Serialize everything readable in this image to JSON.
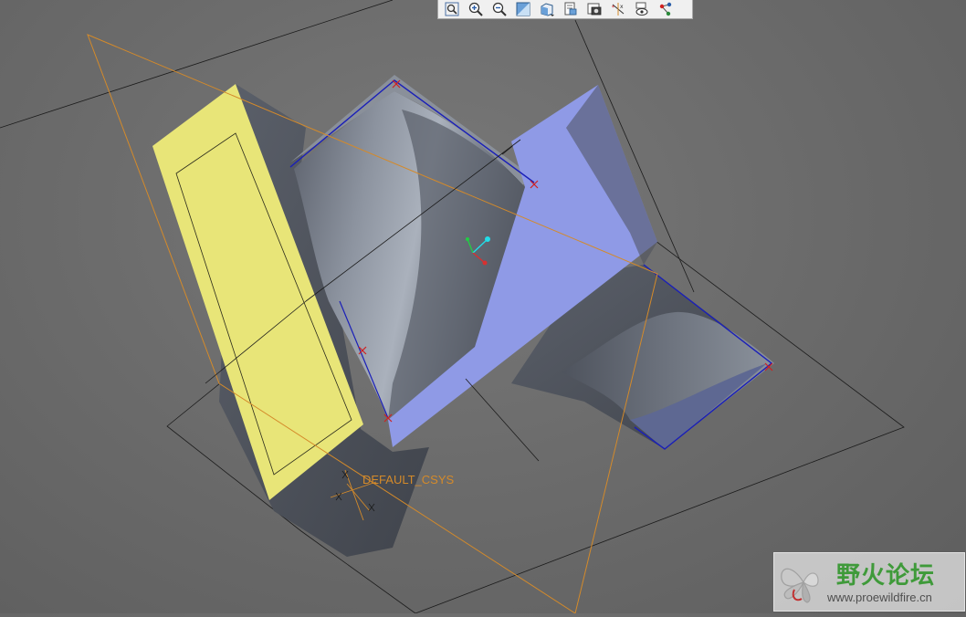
{
  "toolbar": {
    "buttons": [
      {
        "name": "refit-icon"
      },
      {
        "name": "zoom-in-icon"
      },
      {
        "name": "zoom-out-icon"
      },
      {
        "name": "repaint-icon"
      },
      {
        "name": "saved-orientations-icon"
      },
      {
        "name": "view-manager-icon"
      },
      {
        "name": "display-style-icon"
      },
      {
        "name": "datum-display-icon"
      },
      {
        "name": "spin-center-icon"
      },
      {
        "name": "annotation-display-icon"
      }
    ]
  },
  "viewport": {
    "csys_label": "DEFAULT_CSYS"
  },
  "watermark": {
    "title": "野火论坛",
    "url": "www.proewildfire.cn"
  }
}
